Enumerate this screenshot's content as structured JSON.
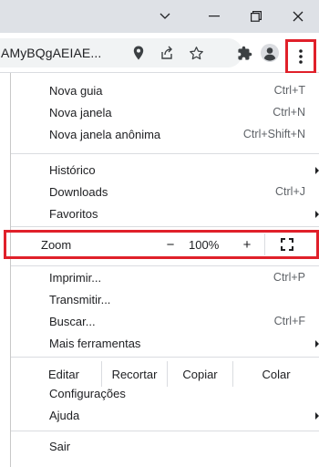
{
  "toolbar": {
    "omnibox_text": "AMyBQgAEIAE..."
  },
  "menu": {
    "group1": [
      {
        "label": "Nova guia",
        "shortcut": "Ctrl+T"
      },
      {
        "label": "Nova janela",
        "shortcut": "Ctrl+N"
      },
      {
        "label": "Nova janela anônima",
        "shortcut": "Ctrl+Shift+N"
      }
    ],
    "group2": [
      {
        "label": "Histórico",
        "shortcut": ""
      },
      {
        "label": "Downloads",
        "shortcut": "Ctrl+J"
      },
      {
        "label": "Favoritos",
        "shortcut": ""
      }
    ],
    "zoom": {
      "label": "Zoom",
      "minus": "−",
      "value": "100%",
      "plus": "+"
    },
    "group3": [
      {
        "label": "Imprimir...",
        "shortcut": "Ctrl+P"
      },
      {
        "label": "Transmitir...",
        "shortcut": ""
      },
      {
        "label": "Buscar...",
        "shortcut": "Ctrl+F"
      },
      {
        "label": "Mais ferramentas",
        "shortcut": ""
      }
    ],
    "edit": {
      "label": "Editar",
      "cut": "Recortar",
      "copy": "Copiar",
      "paste": "Colar"
    },
    "group4": [
      {
        "label": "Configurações",
        "shortcut": ""
      },
      {
        "label": "Ajuda",
        "shortcut": ""
      }
    ],
    "group5": [
      {
        "label": "Sair",
        "shortcut": ""
      }
    ]
  },
  "colors": {
    "highlight": "#e0202a",
    "titlebar": "#dee1e6"
  }
}
